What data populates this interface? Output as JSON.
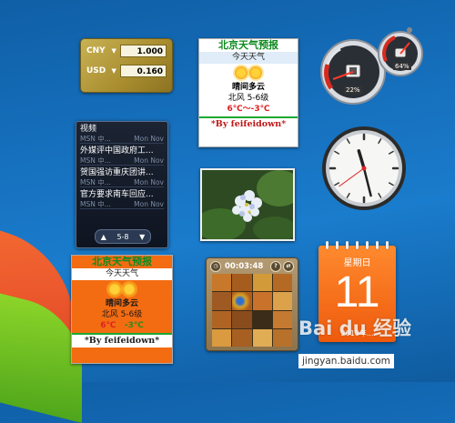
{
  "currency": {
    "rows": [
      {
        "code": "CNY",
        "value": "1.000"
      },
      {
        "code": "USD",
        "value": "0.160"
      }
    ]
  },
  "weather_top": {
    "title": "北京天气预报",
    "day": "今天天气",
    "condition": "晴间多云",
    "wind": "北风  5-6级",
    "temp": "6℃～-3℃",
    "credit": "*By feifeidown*"
  },
  "weather_bottom": {
    "title": "北京天气预报",
    "day": "今天天气",
    "condition": "晴间多云",
    "wind": "北风  5-6级",
    "temp_high": "6℃",
    "temp_low": "-3℃",
    "credit": "*By feifeidown*"
  },
  "news": {
    "items": [
      {
        "title": "视频",
        "source": "MSN 中...",
        "date": "Mon Nov"
      },
      {
        "title": "外媒评中国政府工...",
        "source": "MSN 中...",
        "date": "Mon Nov"
      },
      {
        "title": "贺国强访重庆团讲...",
        "source": "MSN 中...",
        "date": "Mon Nov"
      },
      {
        "title": "官方要求南车回应...",
        "source": "MSN 中...",
        "date": "Mon Nov"
      }
    ],
    "page": "5-8"
  },
  "puzzle": {
    "timer": "00:03:48"
  },
  "cpu": {
    "cpu_percent": "22%",
    "mem_percent": "64%"
  },
  "clock": {
    "hour": 11,
    "minute": 27,
    "second": 39
  },
  "calendar": {
    "weekday": "星期日",
    "day": "11",
    "year_month": "2010年..."
  },
  "watermark": {
    "main": "Bai du 经验",
    "sub": "jingyan.baidu.com"
  },
  "colors": {
    "accent_orange": "#f36c12",
    "weather_green": "#0e8a20",
    "desktop_blue": "#1670bd"
  }
}
